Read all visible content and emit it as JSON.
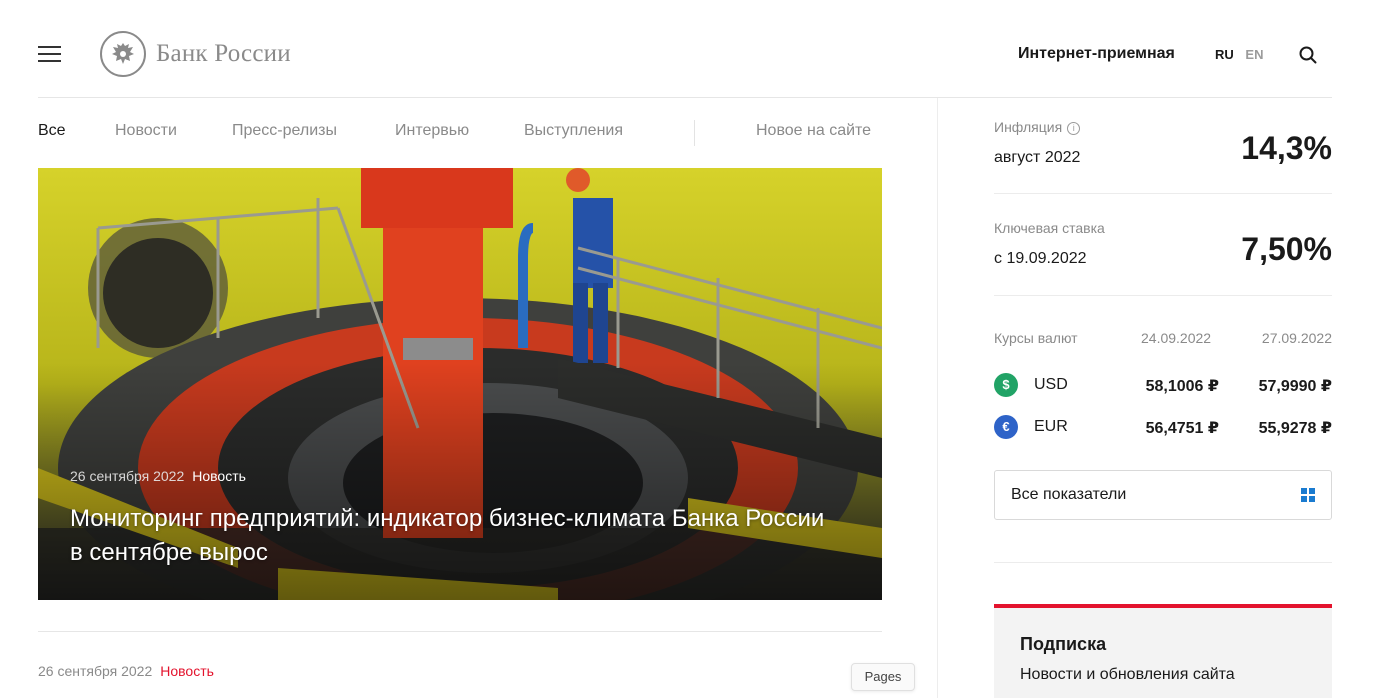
{
  "header": {
    "logo_text": "Банк России",
    "reception": "Интернет-приемная",
    "lang_ru": "RU",
    "lang_en": "EN"
  },
  "tabs": [
    {
      "label": "Все",
      "active": true
    },
    {
      "label": "Новости"
    },
    {
      "label": "Пресс-релизы"
    },
    {
      "label": "Интервью"
    },
    {
      "label": "Выступления"
    },
    {
      "label": "Новое на сайте"
    }
  ],
  "hero": {
    "date": "26 сентября 2022",
    "type": "Новость",
    "title": "Мониторинг предприятий: индикатор бизнес-климата Банка России в сентябре вырос"
  },
  "news2": {
    "date": "26 сентября 2022",
    "type": "Новость"
  },
  "tooltip": "Pages",
  "indicators": {
    "inflation": {
      "label": "Инфляция",
      "sub": "август 2022",
      "value": "14,3%"
    },
    "key_rate": {
      "label": "Ключевая ставка",
      "sub": "с 19.09.2022",
      "value": "7,50%"
    }
  },
  "currencies": {
    "label": "Курсы валют",
    "date1": "24.09.2022",
    "date2": "27.09.2022",
    "rows": [
      {
        "symbol": "$",
        "code": "USD",
        "v1": "58,1006 ₽",
        "v2": "57,9990 ₽",
        "color": "#21a366"
      },
      {
        "symbol": "€",
        "code": "EUR",
        "v1": "56,4751 ₽",
        "v2": "55,9278 ₽",
        "color": "#2e63c8"
      }
    ]
  },
  "all_indicators": "Все показатели",
  "subscription": {
    "title": "Подписка",
    "text": "Новости и обновления сайта"
  },
  "colors": {
    "accent_red": "#e3132d",
    "grid_blue": "#1a7bd0"
  }
}
